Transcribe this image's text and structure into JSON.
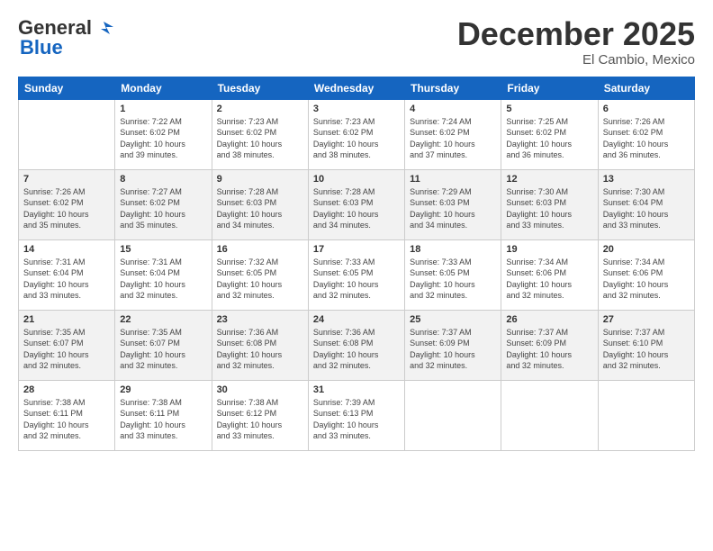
{
  "header": {
    "logo_line1": "General",
    "logo_line2": "Blue",
    "month_year": "December 2025",
    "location": "El Cambio, Mexico"
  },
  "weekdays": [
    "Sunday",
    "Monday",
    "Tuesday",
    "Wednesday",
    "Thursday",
    "Friday",
    "Saturday"
  ],
  "weeks": [
    [
      {
        "num": "",
        "info": ""
      },
      {
        "num": "1",
        "info": "Sunrise: 7:22 AM\nSunset: 6:02 PM\nDaylight: 10 hours\nand 39 minutes."
      },
      {
        "num": "2",
        "info": "Sunrise: 7:23 AM\nSunset: 6:02 PM\nDaylight: 10 hours\nand 38 minutes."
      },
      {
        "num": "3",
        "info": "Sunrise: 7:23 AM\nSunset: 6:02 PM\nDaylight: 10 hours\nand 38 minutes."
      },
      {
        "num": "4",
        "info": "Sunrise: 7:24 AM\nSunset: 6:02 PM\nDaylight: 10 hours\nand 37 minutes."
      },
      {
        "num": "5",
        "info": "Sunrise: 7:25 AM\nSunset: 6:02 PM\nDaylight: 10 hours\nand 36 minutes."
      },
      {
        "num": "6",
        "info": "Sunrise: 7:26 AM\nSunset: 6:02 PM\nDaylight: 10 hours\nand 36 minutes."
      }
    ],
    [
      {
        "num": "7",
        "info": "Sunrise: 7:26 AM\nSunset: 6:02 PM\nDaylight: 10 hours\nand 35 minutes."
      },
      {
        "num": "8",
        "info": "Sunrise: 7:27 AM\nSunset: 6:02 PM\nDaylight: 10 hours\nand 35 minutes."
      },
      {
        "num": "9",
        "info": "Sunrise: 7:28 AM\nSunset: 6:03 PM\nDaylight: 10 hours\nand 34 minutes."
      },
      {
        "num": "10",
        "info": "Sunrise: 7:28 AM\nSunset: 6:03 PM\nDaylight: 10 hours\nand 34 minutes."
      },
      {
        "num": "11",
        "info": "Sunrise: 7:29 AM\nSunset: 6:03 PM\nDaylight: 10 hours\nand 34 minutes."
      },
      {
        "num": "12",
        "info": "Sunrise: 7:30 AM\nSunset: 6:03 PM\nDaylight: 10 hours\nand 33 minutes."
      },
      {
        "num": "13",
        "info": "Sunrise: 7:30 AM\nSunset: 6:04 PM\nDaylight: 10 hours\nand 33 minutes."
      }
    ],
    [
      {
        "num": "14",
        "info": "Sunrise: 7:31 AM\nSunset: 6:04 PM\nDaylight: 10 hours\nand 33 minutes."
      },
      {
        "num": "15",
        "info": "Sunrise: 7:31 AM\nSunset: 6:04 PM\nDaylight: 10 hours\nand 32 minutes."
      },
      {
        "num": "16",
        "info": "Sunrise: 7:32 AM\nSunset: 6:05 PM\nDaylight: 10 hours\nand 32 minutes."
      },
      {
        "num": "17",
        "info": "Sunrise: 7:33 AM\nSunset: 6:05 PM\nDaylight: 10 hours\nand 32 minutes."
      },
      {
        "num": "18",
        "info": "Sunrise: 7:33 AM\nSunset: 6:05 PM\nDaylight: 10 hours\nand 32 minutes."
      },
      {
        "num": "19",
        "info": "Sunrise: 7:34 AM\nSunset: 6:06 PM\nDaylight: 10 hours\nand 32 minutes."
      },
      {
        "num": "20",
        "info": "Sunrise: 7:34 AM\nSunset: 6:06 PM\nDaylight: 10 hours\nand 32 minutes."
      }
    ],
    [
      {
        "num": "21",
        "info": "Sunrise: 7:35 AM\nSunset: 6:07 PM\nDaylight: 10 hours\nand 32 minutes."
      },
      {
        "num": "22",
        "info": "Sunrise: 7:35 AM\nSunset: 6:07 PM\nDaylight: 10 hours\nand 32 minutes."
      },
      {
        "num": "23",
        "info": "Sunrise: 7:36 AM\nSunset: 6:08 PM\nDaylight: 10 hours\nand 32 minutes."
      },
      {
        "num": "24",
        "info": "Sunrise: 7:36 AM\nSunset: 6:08 PM\nDaylight: 10 hours\nand 32 minutes."
      },
      {
        "num": "25",
        "info": "Sunrise: 7:37 AM\nSunset: 6:09 PM\nDaylight: 10 hours\nand 32 minutes."
      },
      {
        "num": "26",
        "info": "Sunrise: 7:37 AM\nSunset: 6:09 PM\nDaylight: 10 hours\nand 32 minutes."
      },
      {
        "num": "27",
        "info": "Sunrise: 7:37 AM\nSunset: 6:10 PM\nDaylight: 10 hours\nand 32 minutes."
      }
    ],
    [
      {
        "num": "28",
        "info": "Sunrise: 7:38 AM\nSunset: 6:11 PM\nDaylight: 10 hours\nand 32 minutes."
      },
      {
        "num": "29",
        "info": "Sunrise: 7:38 AM\nSunset: 6:11 PM\nDaylight: 10 hours\nand 33 minutes."
      },
      {
        "num": "30",
        "info": "Sunrise: 7:38 AM\nSunset: 6:12 PM\nDaylight: 10 hours\nand 33 minutes."
      },
      {
        "num": "31",
        "info": "Sunrise: 7:39 AM\nSunset: 6:13 PM\nDaylight: 10 hours\nand 33 minutes."
      },
      {
        "num": "",
        "info": ""
      },
      {
        "num": "",
        "info": ""
      },
      {
        "num": "",
        "info": ""
      }
    ]
  ]
}
